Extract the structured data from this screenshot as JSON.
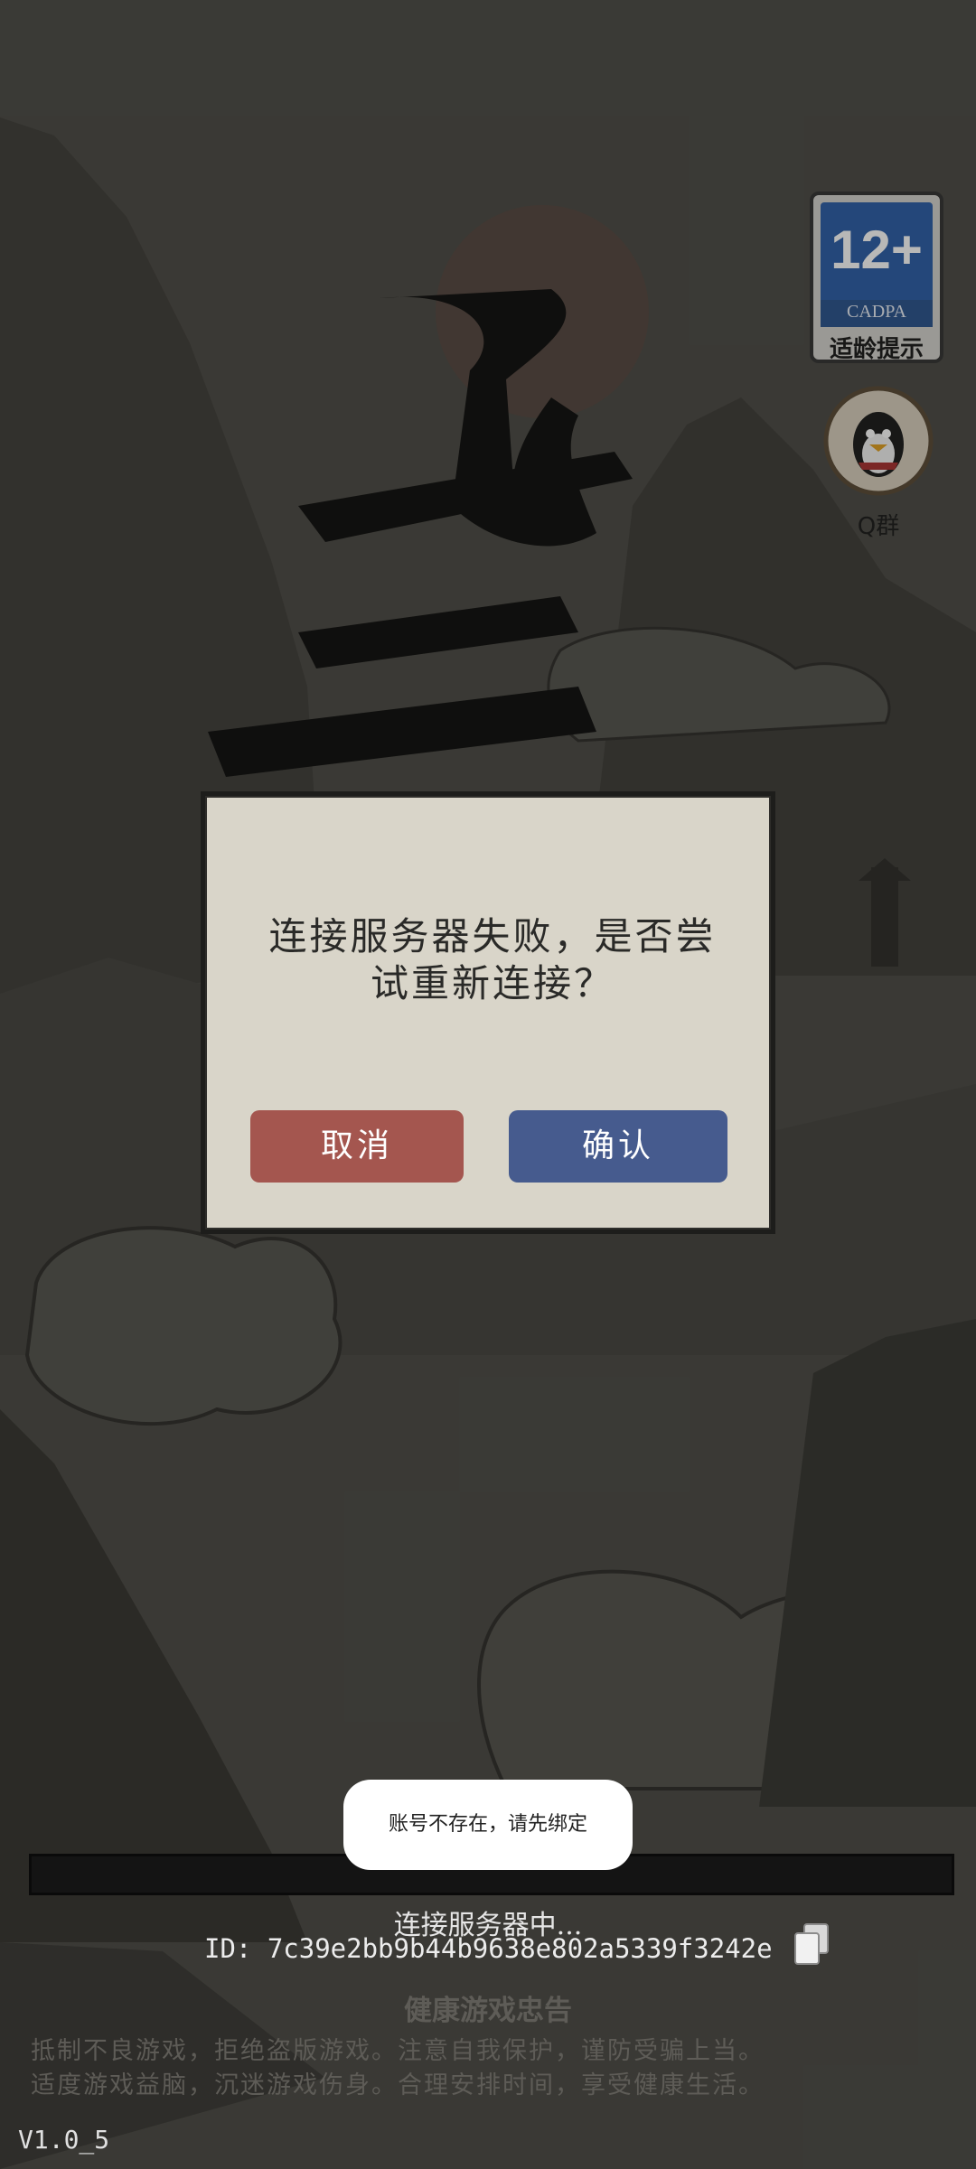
{
  "age_rating": {
    "number": "12+",
    "org": "CADPA",
    "label": "适龄提示",
    "color": "#2b5ea8"
  },
  "qq_group": {
    "label": "Q群",
    "icon": "qq-penguin-icon"
  },
  "title_art": "九天",
  "dialog": {
    "message_line1": "连接服务器失败，是否尝",
    "message_line2": "试重新连接？",
    "cancel_label": "取消",
    "confirm_label": "确认",
    "cancel_color": "#a4564f",
    "confirm_color": "#465b8e"
  },
  "toast": {
    "text": "账号不存在，请先绑定"
  },
  "loading": {
    "status": "连接服务器中...",
    "id_text": "ID:  7c39e2bb9b44b9638e802a5339f3242e",
    "copy_icon": "copy-icon"
  },
  "health_notice": {
    "title": "健康游戏忠告",
    "line1": "抵制不良游戏，拒绝盗版游戏。注意自我保护，谨防受骗上当。",
    "line2": "适度游戏益脑，沉迷游戏伤身。合理安排时间，享受健康生活。"
  },
  "version": "V1.0_5"
}
